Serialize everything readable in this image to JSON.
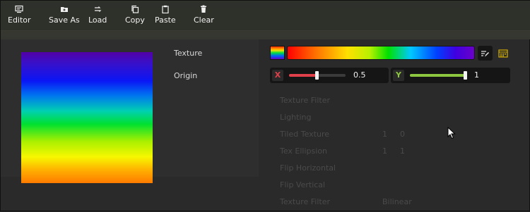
{
  "toolbar": {
    "editor": "Editor",
    "save_as": "Save As",
    "load": "Load",
    "copy": "Copy",
    "paste": "Paste",
    "clear": "Clear"
  },
  "properties": {
    "texture_label": "Texture",
    "origin_label": "Origin",
    "origin_x": {
      "axis": "X",
      "value": "0.5",
      "axis_color": "#e0404a",
      "fill_fraction": 0.5
    },
    "origin_y": {
      "axis": "Y",
      "value": "1",
      "axis_color": "#8dc63f",
      "fill_fraction": 1.0
    }
  },
  "icons": {
    "texture_edit": "edit-list-icon",
    "texture_picker": "gradient-picker-icon"
  },
  "background_ghost": {
    "rows": [
      {
        "label": "Texture Filter",
        "v1": "",
        "v2": ""
      },
      {
        "label": "Lighting",
        "v1": "",
        "v2": ""
      },
      {
        "label": "Tiled Texture",
        "v1": "1",
        "v2": "0"
      },
      {
        "label": "Tex Ellipsion",
        "v1": "1",
        "v2": "1"
      },
      {
        "label": "Flip Horizontal",
        "v1": "",
        "v2": ""
      },
      {
        "label": "Flip Vertical",
        "v1": "",
        "v2": ""
      },
      {
        "label": "Texture Filter",
        "v1": "Bilinear",
        "v2": ""
      }
    ]
  }
}
